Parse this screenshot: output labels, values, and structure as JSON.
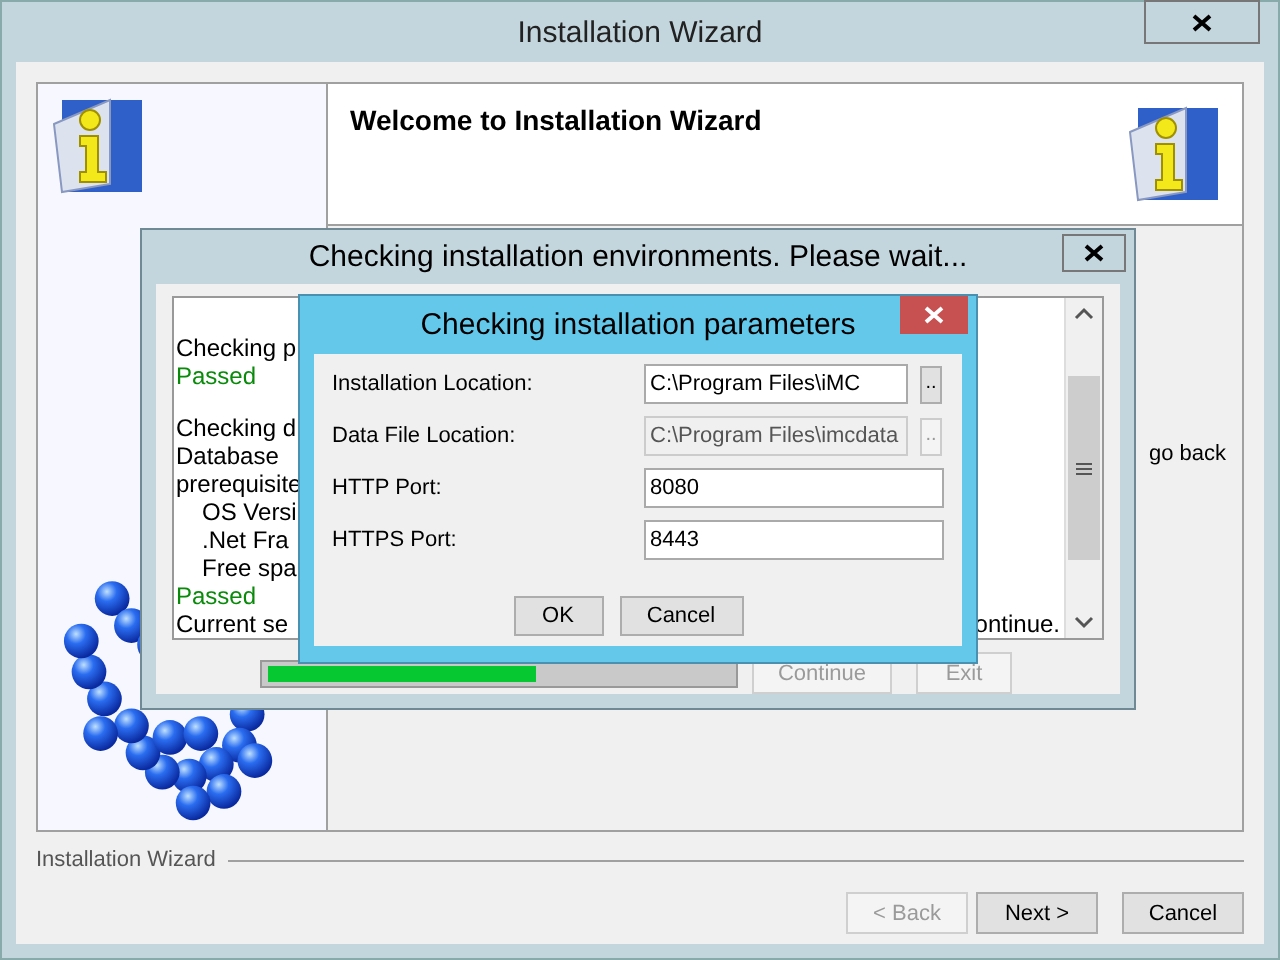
{
  "window": {
    "title": "Installation Wizard"
  },
  "header": {
    "title": "Welcome to Installation Wizard"
  },
  "content": {
    "text_fragment": "go back"
  },
  "footer": {
    "group_label": "Installation Wizard",
    "buttons": [
      {
        "label": "< Back",
        "disabled": true
      },
      {
        "label": "Next >",
        "disabled": false
      },
      {
        "label": "Cancel",
        "disabled": false
      }
    ]
  },
  "environment_dialog": {
    "title": "Checking installation environments. Please wait...",
    "log": [
      {
        "kind": "blank"
      },
      {
        "kind": "text",
        "text": "Checking p",
        "indented": false
      },
      {
        "kind": "passed",
        "text": "Passed",
        "indented": false
      },
      {
        "kind": "blank"
      },
      {
        "kind": "text",
        "text": "Checking d",
        "indented": false
      },
      {
        "kind": "text",
        "text": "Database",
        "indented": false
      },
      {
        "kind": "text",
        "text": "prerequisite",
        "indented": false
      },
      {
        "kind": "text",
        "text": "OS Versi",
        "indented": true
      },
      {
        "kind": "text",
        "text": ".Net Fra",
        "indented": true
      },
      {
        "kind": "text",
        "text": "Free spa",
        "indented": true
      },
      {
        "kind": "passed",
        "text": "Passed",
        "indented": false
      },
      {
        "kind": "text",
        "text": "Current se",
        "indented": false,
        "trailing": "ontinue."
      }
    ],
    "progress": {
      "level": 0.58
    },
    "buttons": [
      {
        "label": "Continue",
        "disabled": true
      },
      {
        "label": "Exit",
        "disabled": true
      }
    ]
  },
  "parameter_dialog": {
    "title": "Checking installation parameters",
    "fields": [
      {
        "label": "Installation Location:",
        "value": "C:\\Program Files\\iMC",
        "disabled": false,
        "browse": ".."
      },
      {
        "label": "Data File Location:",
        "value": "C:\\Program Files\\imcdata",
        "disabled": true,
        "browse": ".."
      },
      {
        "label": "HTTP Port:",
        "value": "8080",
        "disabled": false
      },
      {
        "label": "HTTPS Port:",
        "value": "8443",
        "disabled": false
      }
    ],
    "buttons": [
      {
        "label": "OK"
      },
      {
        "label": "Cancel"
      }
    ]
  }
}
